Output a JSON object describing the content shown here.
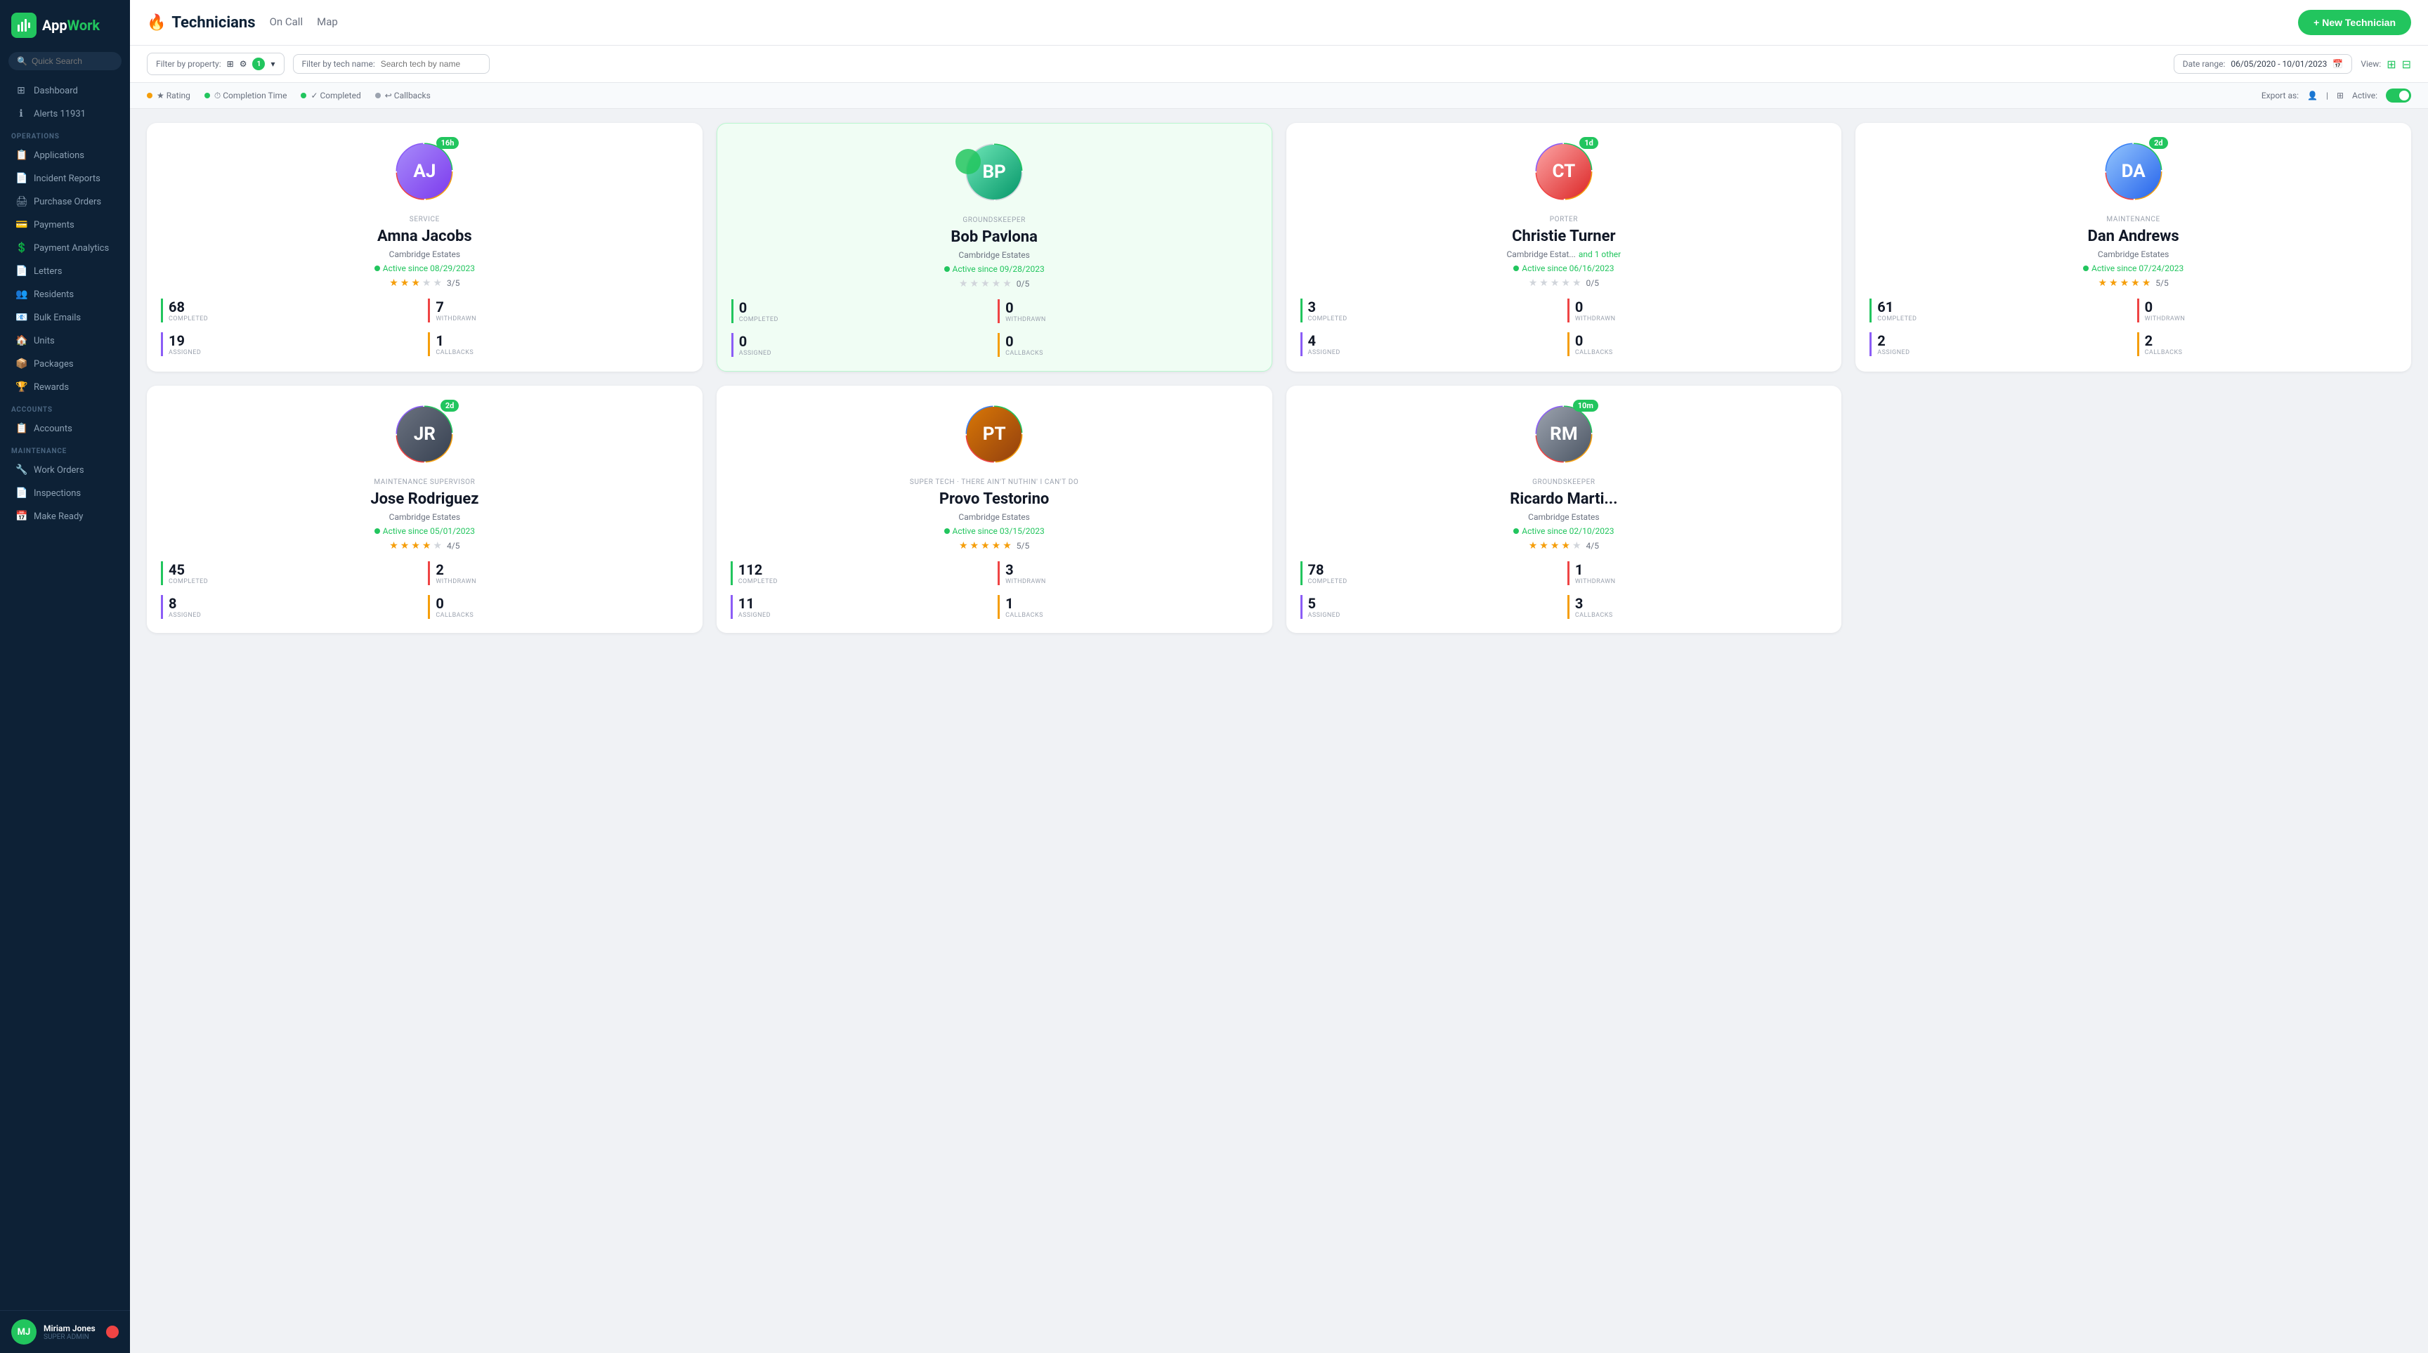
{
  "app": {
    "name": "AppWork",
    "logo_letter": "A"
  },
  "sidebar": {
    "search_placeholder": "Quick Search",
    "nav_top": [
      {
        "id": "dashboard",
        "label": "Dashboard",
        "icon": "⊞"
      },
      {
        "id": "alerts",
        "label": "Alerts 11931",
        "icon": "ℹ"
      }
    ],
    "sections": [
      {
        "label": "OPERATIONS",
        "items": [
          {
            "id": "applications",
            "label": "Applications",
            "icon": "📋"
          },
          {
            "id": "incident-reports",
            "label": "Incident Reports",
            "icon": "📄"
          },
          {
            "id": "purchase-orders",
            "label": "Purchase Orders",
            "icon": "🖨"
          },
          {
            "id": "payments",
            "label": "Payments",
            "icon": "💳"
          },
          {
            "id": "payment-analytics",
            "label": "Payment Analytics",
            "icon": "💲"
          },
          {
            "id": "letters",
            "label": "Letters",
            "icon": "📄"
          },
          {
            "id": "residents",
            "label": "Residents",
            "icon": "👥"
          },
          {
            "id": "bulk-emails",
            "label": "Bulk Emails",
            "icon": "📧"
          },
          {
            "id": "units",
            "label": "Units",
            "icon": "🏠"
          },
          {
            "id": "packages",
            "label": "Packages",
            "icon": "📦"
          },
          {
            "id": "rewards",
            "label": "Rewards",
            "icon": "🏆"
          }
        ]
      },
      {
        "label": "ACCOUNTS",
        "items": [
          {
            "id": "accounts",
            "label": "Accounts",
            "icon": "📋"
          }
        ]
      },
      {
        "label": "MAINTENANCE",
        "items": [
          {
            "id": "work-orders",
            "label": "Work Orders",
            "icon": "🔧"
          },
          {
            "id": "inspections",
            "label": "Inspections",
            "icon": "📄"
          },
          {
            "id": "make-ready",
            "label": "Make Ready",
            "icon": "📅"
          }
        ]
      }
    ],
    "user": {
      "initials": "MJ",
      "name": "Miriam Jones",
      "role": "SUPER ADMIN"
    }
  },
  "header": {
    "title": "Technicians",
    "fire_icon": "🔥",
    "tabs": [
      "On Call",
      "Map"
    ],
    "new_button_label": "+ New Technician"
  },
  "filters": {
    "property_label": "Filter by property:",
    "property_badge": "1",
    "tech_name_label": "Filter by tech name:",
    "tech_name_placeholder": "Search tech by name",
    "date_range_label": "Date range:",
    "date_range_value": "06/05/2020  -  10/01/2023",
    "view_label": "View:"
  },
  "sort_options": [
    {
      "id": "rating",
      "label": "Rating",
      "color": "#f59e0b"
    },
    {
      "id": "completion-time",
      "label": "Completion Time",
      "color": "#22c55e"
    },
    {
      "id": "completed",
      "label": "Completed",
      "color": "#22c55e"
    },
    {
      "id": "callbacks",
      "label": "Callbacks",
      "color": "#9ca3af"
    }
  ],
  "export_label": "Export as:",
  "active_label": "Active:",
  "technicians": [
    {
      "id": "amna-jacobs",
      "role": "SERVICE",
      "name": "Amna Jacobs",
      "property": "Cambridge Estates",
      "property_extra": null,
      "active_since": "08/29/2023",
      "rating": 3,
      "rating_max": 5,
      "score": "3/5",
      "time_badge": "16h",
      "completed": 68,
      "withdrawn": 7,
      "assigned": 19,
      "callbacks": 1,
      "highlighted": false,
      "avatar_emoji": "👨‍💼",
      "ring_colors": [
        "#22c55e",
        "#f59e0b",
        "#ef4444",
        "#8b5cf6"
      ]
    },
    {
      "id": "bob-pavlona",
      "role": "GROUNDSKEEPER",
      "name": "Bob Pavlona",
      "property": "Cambridge Estates",
      "property_extra": null,
      "active_since": "09/28/2023",
      "rating": 0,
      "rating_max": 5,
      "score": "0/5",
      "time_badge": "",
      "completed": 0,
      "withdrawn": 0,
      "assigned": 0,
      "callbacks": 0,
      "highlighted": true,
      "avatar_emoji": "👨",
      "ring_colors": [
        "#22c55e",
        "#d1d5db",
        "#d1d5db",
        "#d1d5db"
      ]
    },
    {
      "id": "christie-turner",
      "role": "PORTER",
      "name": "Christie Turner",
      "property": "Cambridge Estat...",
      "property_extra": "and 1 other",
      "active_since": "06/16/2023",
      "rating": 0,
      "rating_max": 5,
      "score": "0/5",
      "time_badge": "1d",
      "completed": 3,
      "withdrawn": 0,
      "assigned": 4,
      "callbacks": 0,
      "highlighted": false,
      "avatar_emoji": "👩",
      "ring_colors": [
        "#22c55e",
        "#f59e0b",
        "#ef4444",
        "#8b5cf6"
      ]
    },
    {
      "id": "dan-andrews",
      "role": "MAINTENANCE",
      "name": "Dan Andrews",
      "property": "Cambridge Estates",
      "property_extra": null,
      "active_since": "07/24/2023",
      "rating": 5,
      "rating_max": 5,
      "score": "5/5",
      "time_badge": "2d",
      "completed": 61,
      "withdrawn": 0,
      "assigned": 2,
      "callbacks": 2,
      "highlighted": false,
      "avatar_emoji": "👨",
      "ring_colors": [
        "#22c55e",
        "#f59e0b",
        "#ef4444",
        "#3b82f6"
      ]
    },
    {
      "id": "jose-rodriguez",
      "role": "MAINTENANCE SUPERVISOR",
      "name": "Jose Rodriguez",
      "property": "Cambridge Estates",
      "property_extra": null,
      "active_since": "05/01/2023",
      "rating": 4,
      "rating_max": 5,
      "score": "4/5",
      "time_badge": "2d",
      "completed": 45,
      "withdrawn": 2,
      "assigned": 8,
      "callbacks": 0,
      "highlighted": false,
      "avatar_emoji": "👨🏿",
      "ring_colors": [
        "#22c55e",
        "#f59e0b",
        "#ef4444",
        "#8b5cf6"
      ]
    },
    {
      "id": "provo-testorino",
      "role": "SUPER TECH · THERE AIN'T NUTHIN' I CAN'T DO",
      "name": "Provo Testorino",
      "property": "Cambridge Estates",
      "property_extra": null,
      "active_since": "03/15/2023",
      "rating": 5,
      "rating_max": 5,
      "score": "5/5",
      "time_badge": "",
      "completed": 112,
      "withdrawn": 3,
      "assigned": 11,
      "callbacks": 1,
      "highlighted": false,
      "avatar_emoji": "👨🏾",
      "ring_colors": [
        "#22c55e",
        "#f59e0b",
        "#ef4444",
        "#3b82f6"
      ]
    },
    {
      "id": "ricardo-marti",
      "role": "GROUNDSKEEPER",
      "name": "Ricardo Marti...",
      "property": "Cambridge Estates",
      "property_extra": null,
      "active_since": "02/10/2023",
      "rating": 4,
      "rating_max": 5,
      "score": "4/5",
      "time_badge": "10m",
      "completed": 78,
      "withdrawn": 1,
      "assigned": 5,
      "callbacks": 3,
      "highlighted": false,
      "avatar_emoji": "👨",
      "ring_colors": [
        "#22c55e",
        "#f59e0b",
        "#ef4444",
        "#8b5cf6"
      ]
    }
  ],
  "stat_colors": {
    "completed": "#22c55e",
    "withdrawn": "#ef4444",
    "assigned": "#8b5cf6",
    "callbacks": "#f59e0b"
  }
}
